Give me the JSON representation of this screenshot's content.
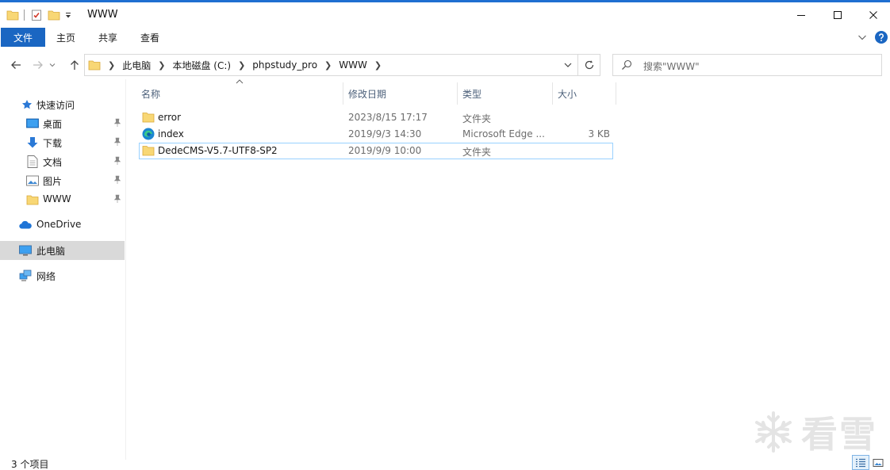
{
  "window": {
    "title": "WWW",
    "controls": {
      "minimize_icon": "minimize-icon",
      "maximize_icon": "maximize-icon",
      "close_icon": "close-icon"
    }
  },
  "ribbon": {
    "file_tab": "文件",
    "tabs": [
      "主页",
      "共享",
      "查看"
    ]
  },
  "address": {
    "crumbs": [
      "此电脑",
      "本地磁盘 (C:)",
      "phpstudy_pro",
      "WWW"
    ]
  },
  "search": {
    "placeholder": "搜索\"WWW\""
  },
  "sidebar": {
    "quick_access": "快速访问",
    "pinned": [
      "桌面",
      "下载",
      "文档",
      "图片",
      "WWW"
    ],
    "onedrive": "OneDrive",
    "this_pc": "此电脑",
    "network": "网络"
  },
  "columns": {
    "name": "名称",
    "date": "修改日期",
    "type": "类型",
    "size": "大小"
  },
  "files": [
    {
      "name": "error",
      "date": "2023/8/15 17:17",
      "type": "文件夹",
      "size": "",
      "icon": "folder-icon"
    },
    {
      "name": "index",
      "date": "2019/9/3 14:30",
      "type": "Microsoft Edge ...",
      "size": "3 KB",
      "icon": "edge-icon"
    },
    {
      "name": "DedeCMS-V5.7-UTF8-SP2",
      "date": "2019/9/9 10:00",
      "type": "文件夹",
      "size": "",
      "icon": "folder-icon"
    }
  ],
  "status": {
    "count": "3 个项目"
  },
  "watermark": {
    "text": "看雪"
  },
  "colors": {
    "accent": "#1a66c2",
    "folder": "#f8d775",
    "selected_bg": "#d9d9d9",
    "focus_border": "#99d1ff"
  }
}
